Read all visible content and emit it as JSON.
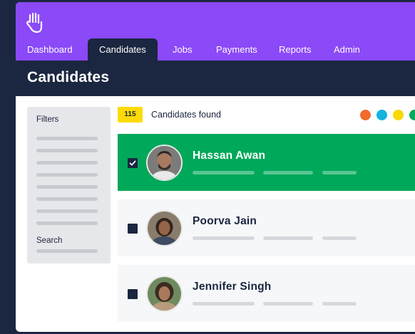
{
  "nav": {
    "tabs": [
      {
        "label": "Dashboard"
      },
      {
        "label": "Candidates",
        "active": true
      },
      {
        "label": "Jobs"
      },
      {
        "label": "Payments"
      },
      {
        "label": "Reports"
      },
      {
        "label": "Admin"
      }
    ]
  },
  "page": {
    "title": "Candidates"
  },
  "filters": {
    "title": "Filters",
    "search_label": "Search"
  },
  "results": {
    "count": "115",
    "count_label": "Candidates found"
  },
  "color_dots": [
    "#f36a2d",
    "#14b3e0",
    "#fad907",
    "#00a85a"
  ],
  "candidates": [
    {
      "name": "Hassan Awan",
      "selected": true
    },
    {
      "name": "Poorva Jain",
      "selected": false
    },
    {
      "name": "Jennifer Singh",
      "selected": false
    }
  ],
  "icons": {
    "logo": "hand-logo-icon",
    "check": "checkmark-icon"
  },
  "colors": {
    "topbar": "#8b49f8",
    "navy": "#1b2640",
    "selected": "#00a85a",
    "badge": "#fddb06"
  }
}
